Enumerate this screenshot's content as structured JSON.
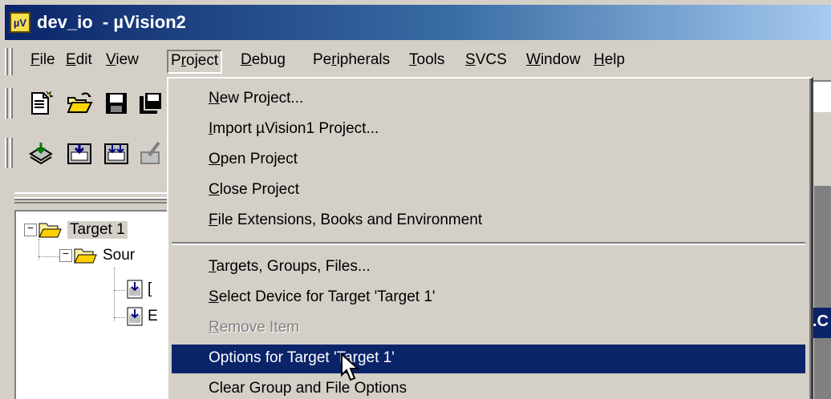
{
  "window": {
    "title": "dev_io  - µVision2",
    "icon": "uv-app-icon"
  },
  "menubar": {
    "items": [
      {
        "id": "file",
        "mn": "F",
        "rest": "ile"
      },
      {
        "id": "edit",
        "mn": "E",
        "rest": "dit"
      },
      {
        "id": "view",
        "mn": "V",
        "rest": "iew"
      },
      {
        "id": "project",
        "pre": "P",
        "mn": "r",
        "rest": "oject"
      },
      {
        "id": "debug",
        "mn": "D",
        "rest": "ebug"
      },
      {
        "id": "peripherals",
        "pre": "Pe",
        "mn": "r",
        "rest": "ipherals"
      },
      {
        "id": "tools",
        "mn": "T",
        "rest": "ools"
      },
      {
        "id": "svcs",
        "mn": "S",
        "rest": "VCS"
      },
      {
        "id": "window",
        "mn": "W",
        "rest": "indow"
      },
      {
        "id": "help",
        "mn": "H",
        "rest": "elp"
      }
    ],
    "open_menu": "Project"
  },
  "toolbar1": {
    "icons": [
      "new-file-icon",
      "open-folder-icon",
      "save-icon",
      "save-all-icon"
    ]
  },
  "toolbar2": {
    "icons": [
      "translate-icon",
      "build-icon",
      "rebuild-icon",
      "stop-build-icon"
    ]
  },
  "project_tree": {
    "target": "Target 1",
    "group": "Sour",
    "files": [
      "[",
      "E"
    ]
  },
  "right_edge": {
    "caption": ".C"
  },
  "project_menu": {
    "groups": [
      [
        {
          "id": "new-project",
          "pre": "",
          "mn": "N",
          "rest": "ew Project...",
          "disabled": false
        },
        {
          "id": "import-uvision1",
          "pre": "",
          "mn": "I",
          "rest": "mport µVision1 Project...",
          "disabled": false
        },
        {
          "id": "open-project",
          "pre": "",
          "mn": "O",
          "rest": "pen Project",
          "disabled": false
        },
        {
          "id": "close-project",
          "pre": "",
          "mn": "C",
          "rest": "lose Project",
          "disabled": false
        },
        {
          "id": "file-extensions",
          "pre": "",
          "mn": "F",
          "rest": "ile Extensions, Books and Environment",
          "disabled": false
        }
      ],
      [
        {
          "id": "targets-groups-files",
          "pre": "",
          "mn": "T",
          "rest": "argets, Groups, Files...",
          "disabled": false
        },
        {
          "id": "select-device",
          "pre": "",
          "mn": "S",
          "rest": "elect Device for Target 'Target 1'",
          "disabled": false
        },
        {
          "id": "remove-item",
          "pre": "",
          "mn": "R",
          "rest": "emove Item",
          "disabled": true
        },
        {
          "id": "options-for-target",
          "pre": "",
          "mn": "",
          "rest": "Options for Target 'Target 1'",
          "disabled": false,
          "highlighted": true
        },
        {
          "id": "clear-group-file-options",
          "pre": "",
          "mn": "",
          "rest": "Clear Group and File Options",
          "disabled": false
        }
      ]
    ]
  },
  "colors": {
    "menu_highlight": "#0a246a",
    "face": "#d4d0c8",
    "title_start": "#0a246a",
    "title_end": "#a6caf0",
    "disabled_text": "#808080"
  }
}
